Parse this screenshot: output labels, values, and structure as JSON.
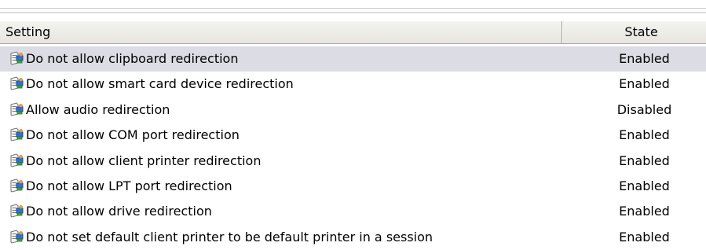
{
  "columns": {
    "setting": "Setting",
    "state": "State"
  },
  "rows": [
    {
      "setting": "Do not allow clipboard redirection",
      "state": "Enabled"
    },
    {
      "setting": "Do not allow smart card device redirection",
      "state": "Enabled"
    },
    {
      "setting": "Allow audio redirection",
      "state": "Disabled"
    },
    {
      "setting": "Do not allow COM port redirection",
      "state": "Enabled"
    },
    {
      "setting": "Do not allow client printer redirection",
      "state": "Enabled"
    },
    {
      "setting": "Do not allow LPT port redirection",
      "state": "Enabled"
    },
    {
      "setting": "Do not allow drive redirection",
      "state": "Enabled"
    },
    {
      "setting": "Do not set default client printer to be default printer in a session",
      "state": "Enabled"
    }
  ],
  "row_icon": "policy-setting-icon",
  "colors": {
    "selected_row": "#dcdce4",
    "header_bg": "#ecebe5"
  }
}
